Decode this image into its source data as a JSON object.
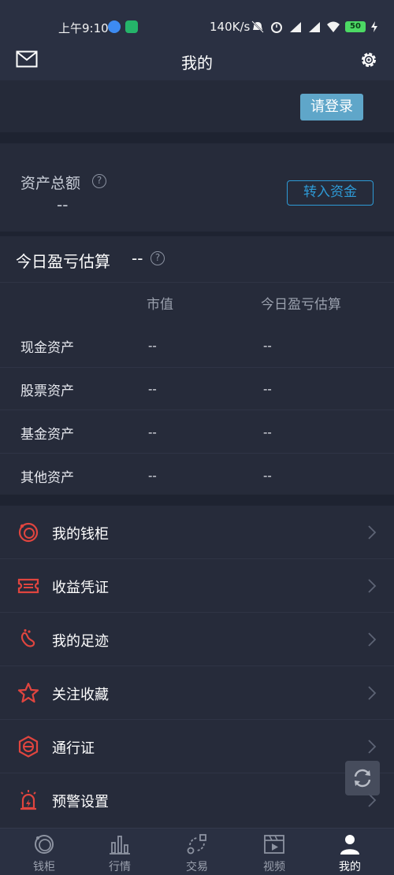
{
  "status_bar": {
    "time": "上午9:10",
    "net_speed": "140K/s",
    "battery": "50",
    "icons": [
      "bell-off-icon",
      "alarm-icon",
      "signal-hd-icon",
      "signal-hd-icon",
      "wifi-icon",
      "battery-icon",
      "charging-icon"
    ]
  },
  "header": {
    "title": "我的"
  },
  "login": {
    "button_label": "请登录"
  },
  "assets": {
    "label": "资产总额",
    "value": "--",
    "transfer_label": "转入资金"
  },
  "pnl": {
    "title": "今日盈亏估算",
    "value": "--",
    "columns": [
      "市值",
      "今日盈亏估算"
    ],
    "rows": [
      {
        "label": "现金资产",
        "market_value": "--",
        "pnl": "--"
      },
      {
        "label": "股票资产",
        "market_value": "--",
        "pnl": "--"
      },
      {
        "label": "基金资产",
        "market_value": "--",
        "pnl": "--"
      },
      {
        "label": "其他资产",
        "market_value": "--",
        "pnl": "--"
      }
    ]
  },
  "menu": [
    {
      "label": "我的钱柜",
      "icon": "wallet-icon"
    },
    {
      "label": "收益凭证",
      "icon": "ticket-icon"
    },
    {
      "label": "我的足迹",
      "icon": "footprint-icon"
    },
    {
      "label": "关注收藏",
      "icon": "star-icon"
    },
    {
      "label": "通行证",
      "icon": "passport-icon"
    },
    {
      "label": "预警设置",
      "icon": "alarm-light-icon"
    }
  ],
  "tabs": [
    {
      "label": "钱柜",
      "icon": "wallet-tab-icon",
      "active": false
    },
    {
      "label": "行情",
      "icon": "bar-chart-icon",
      "active": false
    },
    {
      "label": "交易",
      "icon": "exchange-icon",
      "active": false
    },
    {
      "label": "视频",
      "icon": "video-icon",
      "active": false
    },
    {
      "label": "我的",
      "icon": "person-icon",
      "active": true
    }
  ],
  "colors": {
    "accent_red": "#e0453f",
    "accent_blue": "#2e9ad6",
    "login_button": "#5fa6c9",
    "background": "#1e2331"
  }
}
